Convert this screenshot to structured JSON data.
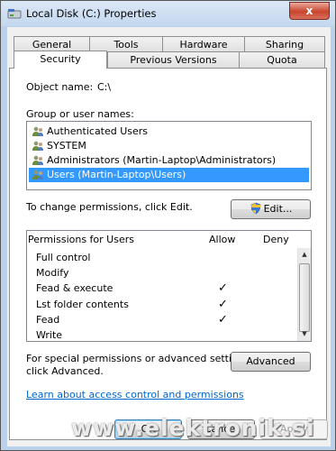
{
  "window": {
    "title": "Local Disk (C:) Properties",
    "close_label": "x"
  },
  "tabs": {
    "row1": [
      "General",
      "Tools",
      "Hardware",
      "Sharing"
    ],
    "row2": [
      "Security",
      "Previous Versions",
      "Quota"
    ],
    "active": "Security"
  },
  "security": {
    "object_name_label": "Object name:",
    "object_name_value": "C:\\",
    "groups_label": "Group or user names:",
    "groups": [
      {
        "label": "Authenticated Users",
        "icon": "users-icon"
      },
      {
        "label": "SYSTEM",
        "icon": "users-icon"
      },
      {
        "label": "Administrators (Martin-Laptop\\Administrators)",
        "icon": "users-icon"
      },
      {
        "label": "Users (Martin-Laptop\\Users)",
        "icon": "users-icon",
        "selected": true
      }
    ],
    "change_hint": "To change permissions, click Edit.",
    "edit_button": "Edit...",
    "permissions_header": "Permissions for Users",
    "allow_header": "Allow",
    "deny_header": "Deny",
    "permissions": [
      {
        "name": "Full control",
        "allow": false,
        "deny": false
      },
      {
        "name": "Modify",
        "allow": false,
        "deny": false
      },
      {
        "name": "Fead & execute",
        "allow": true,
        "deny": false
      },
      {
        "name": "Lst folder contents",
        "allow": true,
        "deny": false
      },
      {
        "name": "Fead",
        "allow": true,
        "deny": false
      },
      {
        "name": "Write",
        "allow": false,
        "deny": false
      }
    ],
    "check_glyph": "✓",
    "special_hint_line1": "For special permissions or advanced settings,",
    "special_hint_line2": "click Advanced.",
    "advanced_button": "Advanced",
    "learn_link": "Learn about access control and permissions"
  },
  "footer": {
    "ok": "OK",
    "cancel": "Cancel",
    "apply": "Apply"
  },
  "watermark": "www.elektronik.si",
  "colors": {
    "selection": "#3399ff",
    "link": "#0066cc",
    "close_button": "#c8452f",
    "frame": "#b9d1ea"
  }
}
